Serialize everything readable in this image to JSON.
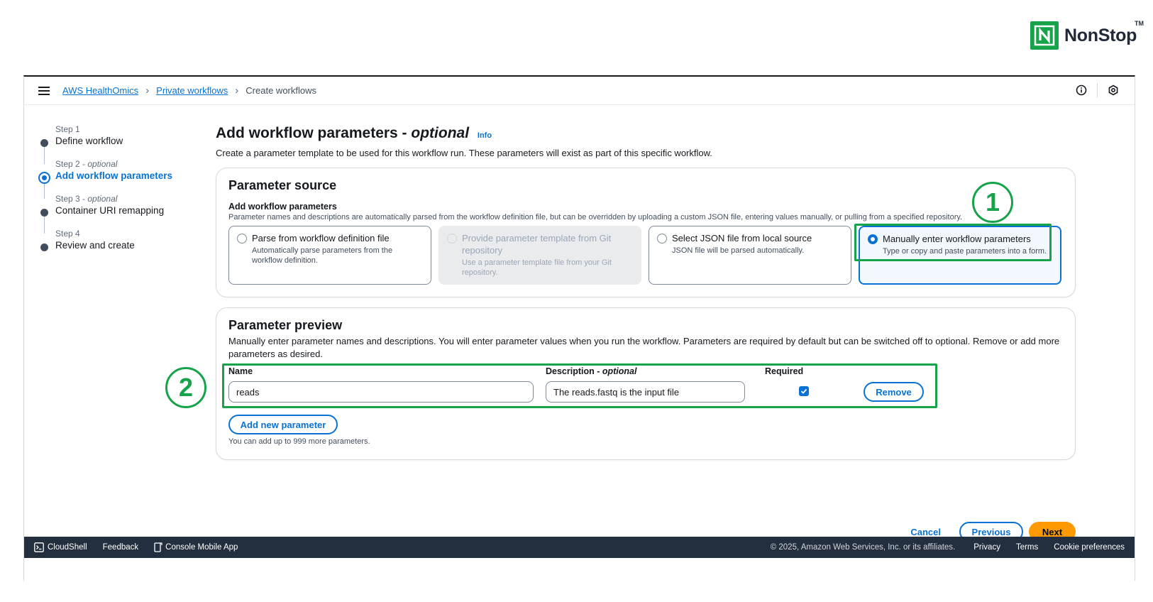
{
  "brand": {
    "name": "NonStop",
    "trademark": "TM"
  },
  "breadcrumb": [
    {
      "label": "AWS HealthOmics"
    },
    {
      "label": "Private workflows"
    },
    {
      "label": "Create workflows"
    }
  ],
  "steps": [
    {
      "num": "Step 1",
      "optional": "",
      "title": "Define workflow",
      "state": "done"
    },
    {
      "num": "Step 2",
      "optional": "optional",
      "title": "Add workflow parameters",
      "state": "active"
    },
    {
      "num": "Step 3",
      "optional": "optional",
      "title": "Container URI remapping",
      "state": "todo"
    },
    {
      "num": "Step 4",
      "optional": "",
      "title": "Review and create",
      "state": "todo"
    }
  ],
  "page": {
    "title": "Add workflow parameters - ",
    "title_optional": "optional",
    "info": "Info",
    "description": "Create a parameter template to be used for this workflow run. These parameters will exist as part of this specific workflow."
  },
  "source": {
    "heading": "Parameter source",
    "label": "Add workflow parameters",
    "desc": "Parameter names and descriptions are automatically parsed from the workflow definition file, but can be overridden by uploading a custom JSON file, entering values manually, or pulling from a specified repository.",
    "options": [
      {
        "title": "Parse from workflow definition file",
        "desc": "Automatically parse parameters from the workflow definition."
      },
      {
        "title": "Provide parameter template from Git repository",
        "desc": "Use a parameter template file from your Git repository."
      },
      {
        "title": "Select JSON file from local source",
        "desc": "JSON file will be parsed automatically."
      },
      {
        "title": "Manually enter workflow parameters",
        "desc": "Type or copy and paste parameters into a form."
      }
    ],
    "selected_index": 3
  },
  "preview": {
    "heading": "Parameter preview",
    "desc": "Manually enter parameter names and descriptions. You will enter parameter values when you run the workflow. Parameters are required by default but can be switched off to optional. Remove or add more parameters as desired.",
    "col_name": "Name",
    "col_desc": "Description - ",
    "col_desc_optional": "optional",
    "col_required": "Required",
    "row": {
      "name": "reads",
      "description": "The reads.fastq is the input file",
      "required": true
    },
    "remove_label": "Remove",
    "add_label": "Add new parameter",
    "hint": "You can add up to 999 more parameters."
  },
  "actions": {
    "cancel": "Cancel",
    "previous": "Previous",
    "next": "Next"
  },
  "annotations": {
    "one": "1",
    "two": "2"
  },
  "footer": {
    "cloudshell": "CloudShell",
    "feedback": "Feedback",
    "mobile": "Console Mobile App",
    "copyright": "© 2025, Amazon Web Services, Inc. or its affiliates.",
    "privacy": "Privacy",
    "terms": "Terms",
    "cookies": "Cookie preferences"
  },
  "colors": {
    "accent": "#0972d3",
    "primary_button": "#ff9900",
    "annotation": "#16a34a",
    "footer_bg": "#232f3e"
  }
}
